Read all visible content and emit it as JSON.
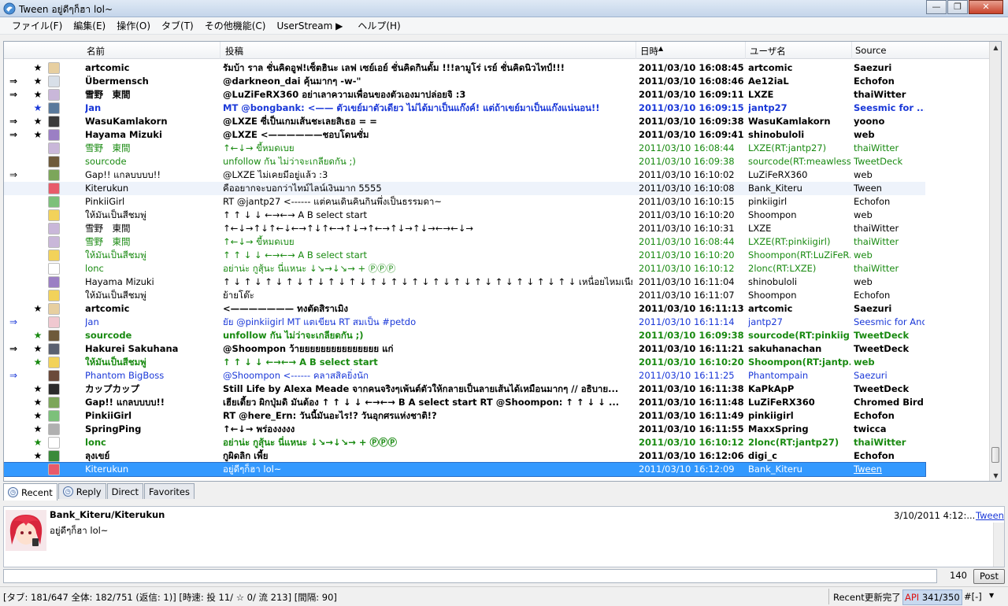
{
  "window": {
    "title": "Tween อยู่ดีๆก็ฮา lol~"
  },
  "menu": [
    {
      "label": "ファイル(F)"
    },
    {
      "label": "編集(E)"
    },
    {
      "label": "操作(O)"
    },
    {
      "label": "タブ(T)"
    },
    {
      "label": "その他機能(C)"
    },
    {
      "label": "UserStream ▶"
    },
    {
      "label": "ヘルプ(H)"
    }
  ],
  "columns": {
    "name": "名前",
    "text": "投稿",
    "date": "日時",
    "user": "ユーザ名",
    "source": "Source"
  },
  "tweets": [
    {
      "mark": "",
      "fav": "★",
      "name": "artcomic",
      "text": "รัมบ้า ราล ชั่นคิดอูฟ!เซ็ตฮินะ เลฟ เซย์เอย์ ชั่นคิดกินดั้ม !!!ลามูโร่ เรย์ ชั่นคิดนิวไทป์!!!",
      "date": "2011/03/10 16:08:45",
      "user": "artcomic",
      "source": "Saezuri",
      "style": "unread",
      "avatar": "#e7cfa0"
    },
    {
      "mark": "⇒",
      "fav": "★",
      "name": "Übermensch",
      "text": "@darkneon_dai คุ้นมากๆ -w-\"",
      "date": "2011/03/10 16:08:46",
      "user": "Ae12iaL",
      "source": "Echofon",
      "style": "unread",
      "avatar": "#d8dfe8"
    },
    {
      "mark": "⇒",
      "fav": "★",
      "name": "雪野　東間",
      "text": "@LuZiFeRX360 อย่าเลาความเพื่อนของตัวเองมาปล่อยจิ :3",
      "date": "2011/03/10 16:09:11",
      "user": "LXZE",
      "source": "thaiWitter",
      "style": "unread",
      "avatar": "#c9b7d9"
    },
    {
      "mark": "",
      "fav": "★",
      "name": "Jan",
      "text": "MT @bongbank: <—— ตัวเขย์มาตัวเดียว ไม่ได้มาเป็นแก๊งค์! แต่ถ้าเขย์มาเป็นแก๊งแน่นอน!!",
      "date": "2011/03/10 16:09:15",
      "user": "jantp27",
      "source": "Seesmic for ...",
      "style": "unread blue",
      "avatar": "#5a7a9c"
    },
    {
      "mark": "⇒",
      "fav": "★",
      "name": "WasuKamlakorn",
      "text": "@LXZE ซี่เป็นเกมเส้นชะเลยสิเธอ = =",
      "date": "2011/03/10 16:09:38",
      "user": "WasuKamlakorn",
      "source": "yoono",
      "style": "unread",
      "avatar": "#3b3b3b"
    },
    {
      "mark": "⇒",
      "fav": "★",
      "name": "Hayama Mizuki",
      "text": "@LXZE <——————ชอบโดนซั่ม",
      "date": "2011/03/10 16:09:41",
      "user": "shinobuloli",
      "source": "web",
      "style": "unread",
      "avatar": "#9b7fc4"
    },
    {
      "mark": "",
      "fav": "",
      "name": "雪野　東間",
      "text": "↑←↓→ ขี้หมดเบย",
      "date": "2011/03/10 16:08:44",
      "user": "LXZE(RT:jantp27)",
      "source": "thaiWitter",
      "style": "green",
      "avatar": "#c9b7d9"
    },
    {
      "mark": "",
      "fav": "",
      "name": "sourcode",
      "text": "unfollow กัน ไม่ว่าจะเกลียดกัน ;)",
      "date": "2011/03/10 16:09:38",
      "user": "sourcode(RT:meawless)",
      "source": "TweetDeck",
      "style": "green",
      "avatar": "#6e5a3b"
    },
    {
      "mark": "⇒",
      "fav": "",
      "name": "Gap!!  แกลบบบบ!!",
      "text": "@LXZE ไม่เคยมีอยู่แล้ว :3",
      "date": "2011/03/10 16:10:02",
      "user": "LuZiFeRX360",
      "source": "web",
      "style": "",
      "avatar": "#7ca65a"
    },
    {
      "mark": "",
      "fav": "",
      "name": "Kiterukun",
      "text": "คืออยากจะบอกว่าไทม์ไลน์เงินมาก 5555",
      "date": "2011/03/10 16:10:08",
      "user": "Bank_Kiteru",
      "source": "Tween",
      "style": "alt",
      "avatar": "#e85a6a"
    },
    {
      "mark": "",
      "fav": "",
      "name": "PinkiiGirl",
      "text": "RT @jantp27 <------ แต่คนเดินคินกินพึ่งเป็นธรรมดา~",
      "date": "2011/03/10 16:10:15",
      "user": "pinkiigirl",
      "source": "Echofon",
      "style": "",
      "avatar": "#7cc07a"
    },
    {
      "mark": "",
      "fav": "",
      "name": "ให้มันเป็นสีชมพู่",
      "text": "↑ ↑ ↓ ↓ ←→←→  A  B  select  start",
      "date": "2011/03/10 16:10:20",
      "user": "Shoompon",
      "source": "web",
      "style": "",
      "avatar": "#f2d25a"
    },
    {
      "mark": "",
      "fav": "",
      "name": "雪野　東間",
      "text": "↑←↓→↑↓↑←↓←→↑↓↑←→↑↓→↑←→↑↓→↑↓→←→←↓→",
      "date": "2011/03/10 16:10:31",
      "user": "LXZE",
      "source": "thaiWitter",
      "style": "",
      "avatar": "#c9b7d9"
    },
    {
      "mark": "",
      "fav": "",
      "name": "雪野　東間",
      "text": "↑←↓→ ขี้หมดเบย",
      "date": "2011/03/10 16:08:44",
      "user": "LXZE(RT:pinkiigirl)",
      "source": "thaiWitter",
      "style": "green",
      "avatar": "#c9b7d9"
    },
    {
      "mark": "",
      "fav": "",
      "name": "ให้มันเป็นสีชมพู่",
      "text": "↑ ↑ ↓ ↓ ←→←→  A  B  select  start",
      "date": "2011/03/10 16:10:20",
      "user": "Shoompon(RT:LuZiFeR...",
      "source": "web",
      "style": "green",
      "avatar": "#f2d25a"
    },
    {
      "mark": "",
      "fav": "",
      "name": "lonc",
      "text": "อย่าน่ะ กูสุ้นะ นี่แหนะ ↓↘→↓↘→ + ⓅⓅⓅ",
      "date": "2011/03/10 16:10:12",
      "user": "2lonc(RT:LXZE)",
      "source": "thaiWitter",
      "style": "green",
      "avatar": "#ffffff"
    },
    {
      "mark": "",
      "fav": "",
      "name": "Hayama Mizuki",
      "text": "↑ ↓ ↑ ↓ ↑ ↓ ↑ ↓ ↑ ↓ ↑ ↓ ↑ ↓ ↑ ↓ ↑ ↓ ↑ ↓ ↑ ↓ ↑ ↓ ↑ ↓ ↑ ↓ ↑ ↓ ↑ ↓ ↑ ↓  เหนื่อยไหมเนีย",
      "date": "2011/03/10 16:11:04",
      "user": "shinobuloli",
      "source": "web",
      "style": "",
      "avatar": "#9b7fc4"
    },
    {
      "mark": "",
      "fav": "",
      "name": "ให้มันเป็นสีชมพู่",
      "text": "ย้ายโต๊ะ",
      "date": "2011/03/10 16:11:07",
      "user": "Shoompon",
      "source": "Echofon",
      "style": "",
      "avatar": "#f2d25a"
    },
    {
      "mark": "",
      "fav": "★",
      "name": "artcomic",
      "text": "<——————— ทงตัดสิราเมิง",
      "date": "2011/03/10 16:11:13",
      "user": "artcomic",
      "source": "Saezuri",
      "style": "unread",
      "avatar": "#e7cfa0"
    },
    {
      "mark": "⇒",
      "fav": "",
      "name": "Jan",
      "text": "ยัย @pinkiigirl MT แตเขียน RT สมเป็น #petdo",
      "date": "2011/03/10 16:11:14",
      "user": "jantp27",
      "source": "Seesmic for Andr...",
      "style": "blue",
      "avatar": "#f0c8d0"
    },
    {
      "mark": "",
      "fav": "★",
      "name": "sourcode",
      "text": "unfollow กัน ไม่ว่าจะเกลียดกัน ;)",
      "date": "2011/03/10 16:09:38",
      "user": "sourcode(RT:pinkiig...",
      "source": "TweetDeck",
      "style": "unread green",
      "avatar": "#6e5a3b"
    },
    {
      "mark": "⇒",
      "fav": "★",
      "name": "Hakurei Sakuhana",
      "text": "@Shoompon ว้ายยยยยยยยยยยยยยย แก่",
      "date": "2011/03/10 16:11:21",
      "user": "sakuhanachan",
      "source": "TweetDeck",
      "style": "unread",
      "avatar": "#5a6070"
    },
    {
      "mark": "",
      "fav": "★",
      "name": "ให้มันเป็นสีชมพู่",
      "text": "↑ ↑ ↓ ↓ ←→←→  A  B  select  start",
      "date": "2011/03/10 16:10:20",
      "user": "Shoompon(RT:jantp...",
      "source": "web",
      "style": "unread green",
      "avatar": "#f2d25a"
    },
    {
      "mark": "⇒",
      "fav": "",
      "name": "Phantom BigBoss",
      "text": "@Shoompon <------ คลาสสิคยิ่งนัก",
      "date": "2011/03/10 16:11:25",
      "user": "Phantompain",
      "source": "Saezuri",
      "style": "blue",
      "avatar": "#6a4a3a"
    },
    {
      "mark": "",
      "fav": "★",
      "name": "カップカップ",
      "text": "Still Life by Alexa Meade จากคนจริงๆเพ้นต์ตัวให้กลายเป็นลายเส้นได้เหมือนมากๆ // อธิบาย...",
      "date": "2011/03/10 16:11:38",
      "user": "KaPkApP",
      "source": "TweetDeck",
      "style": "unread",
      "avatar": "#2b2b2b"
    },
    {
      "mark": "",
      "fav": "★",
      "name": "Gap!!  แกลบบบบ!!",
      "text": "เฮียเตี้ยว ผิกปุ่มดิ มันต้อง ↑ ↑ ↓ ↓ ←→←→  B A select  start RT @Shoompon: ↑ ↑ ↓ ↓ ...",
      "date": "2011/03/10 16:11:48",
      "user": "LuZiFeRX360",
      "source": "Chromed Bird",
      "style": "unread",
      "avatar": "#7ca65a"
    },
    {
      "mark": "",
      "fav": "★",
      "name": "PinkiiGirl",
      "text": "RT @here_Ern: วันนี้มันอะไร!?  วันอุกศรแห่งชาติ!?",
      "date": "2011/03/10 16:11:49",
      "user": "pinkiigirl",
      "source": "Echofon",
      "style": "unread",
      "avatar": "#7cc07a"
    },
    {
      "mark": "",
      "fav": "★",
      "name": "SpringPing",
      "text": "↑←↓→ พร่องงงงง",
      "date": "2011/03/10 16:11:55",
      "user": "MaxxSpring",
      "source": "twicca",
      "style": "unread",
      "avatar": "#b0b0b0"
    },
    {
      "mark": "",
      "fav": "★",
      "name": "lonc",
      "text": "อย่าน่ะ กูสุ้นะ นี่แหนะ ↓↘→↓↘→ + ⓅⓅⓅ",
      "date": "2011/03/10 16:10:12",
      "user": "2lonc(RT:jantp27)",
      "source": "thaiWitter",
      "style": "unread green",
      "avatar": "#ffffff"
    },
    {
      "mark": "",
      "fav": "★",
      "name": "ลุงเขย์",
      "text": "กูผิดลิก เพี้ย",
      "date": "2011/03/10 16:12:06",
      "user": "digi_c",
      "source": "Echofon",
      "style": "unread",
      "avatar": "#3a8a3a"
    },
    {
      "mark": "",
      "fav": "",
      "name": "Kiterukun",
      "text": "อยู่ดีๆก็ฮา lol~",
      "date": "2011/03/10 16:12:09",
      "user": "Bank_Kiteru",
      "source": "Tween",
      "style": "sel",
      "avatar": "#e85a6a"
    }
  ],
  "tabs": [
    {
      "label": "Recent",
      "icon": "clock-icon",
      "active": true
    },
    {
      "label": "Reply",
      "icon": "clock-icon",
      "active": false
    },
    {
      "label": "Direct",
      "active": false
    },
    {
      "label": "Favorites",
      "active": false
    }
  ],
  "detail": {
    "name": "Bank_Kiteru/Kiterukun",
    "date": "3/10/2011 4:12:...",
    "source": "Tween",
    "text": "อยู่ดีๆก็ฮา lol~"
  },
  "post": {
    "count": "140",
    "button": "Post"
  },
  "status": {
    "counts": "[タブ: 181/647 全体: 182/751 (返信: 1)] [時速: 投 11/ ☆ 0/ 流 213] [間隔: 90]",
    "message": "Recent更新完了",
    "api_prefix": "API",
    "api_value": " 341/350",
    "hash": "#[-]"
  },
  "colors": {
    "unread": "#000000",
    "retweet_green": "#198a11",
    "reply_blue": "#1a38d8",
    "selected": "#3399ff"
  }
}
